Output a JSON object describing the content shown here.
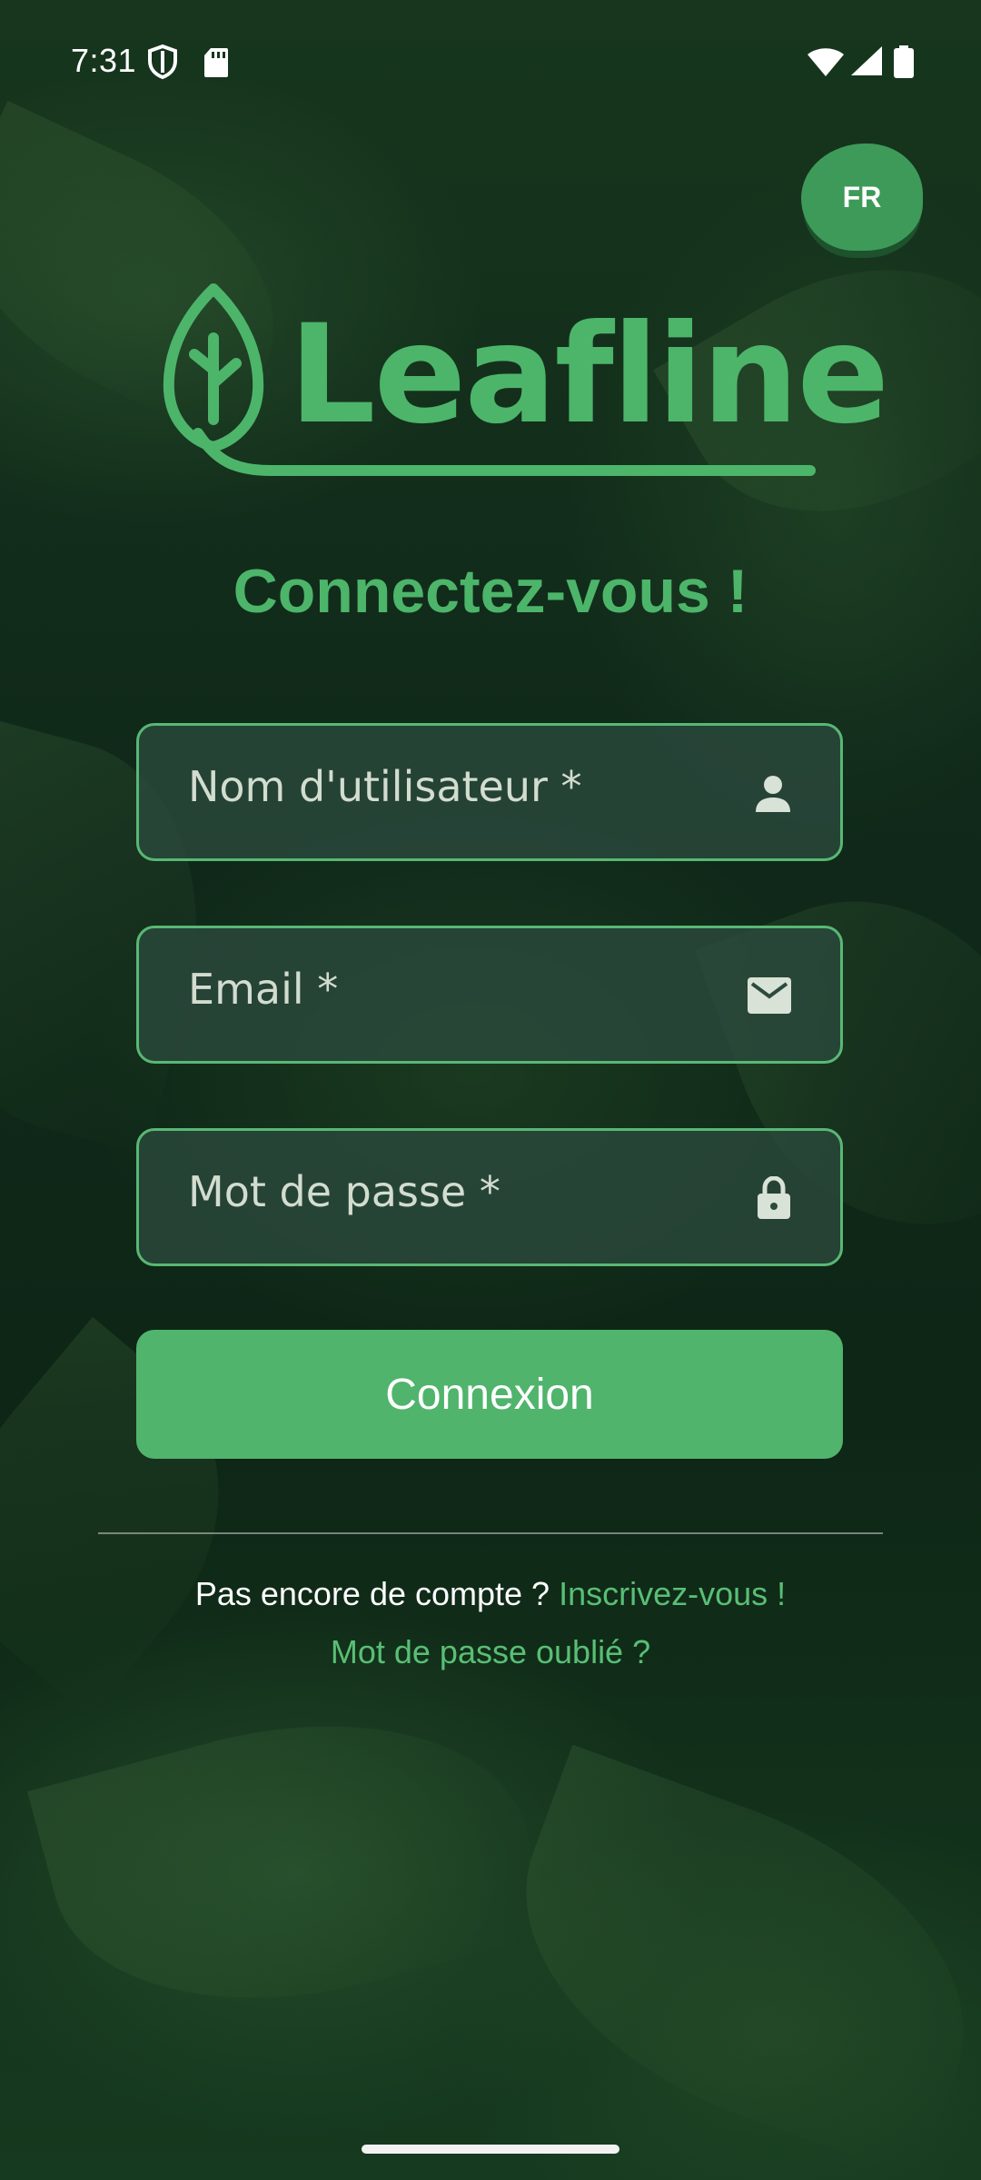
{
  "status_bar": {
    "time": "7:31",
    "icons": [
      "shield-icon",
      "sd-card-icon",
      "wifi-icon",
      "signal-icon",
      "battery-icon"
    ]
  },
  "language_button": {
    "label": "FR"
  },
  "logo": {
    "text": "Leafline",
    "icon": "leaf-icon"
  },
  "title": "Connectez-vous !",
  "form": {
    "username": {
      "placeholder": "Nom d'utilisateur *",
      "value": "",
      "icon": "person-icon"
    },
    "email": {
      "placeholder": "Email *",
      "value": "",
      "icon": "mail-icon"
    },
    "password": {
      "placeholder": "Mot de passe *",
      "value": "",
      "icon": "lock-icon"
    },
    "submit_label": "Connexion"
  },
  "footer": {
    "no_account_text": "Pas encore de compte ?",
    "signup_link": "Inscrivez-vous !",
    "forgot_link": "Mot de passe oublié ?"
  },
  "colors": {
    "accent": "#4cb56a",
    "button": "#50b46c",
    "field_border": "#58b874",
    "link": "#59bf74"
  }
}
